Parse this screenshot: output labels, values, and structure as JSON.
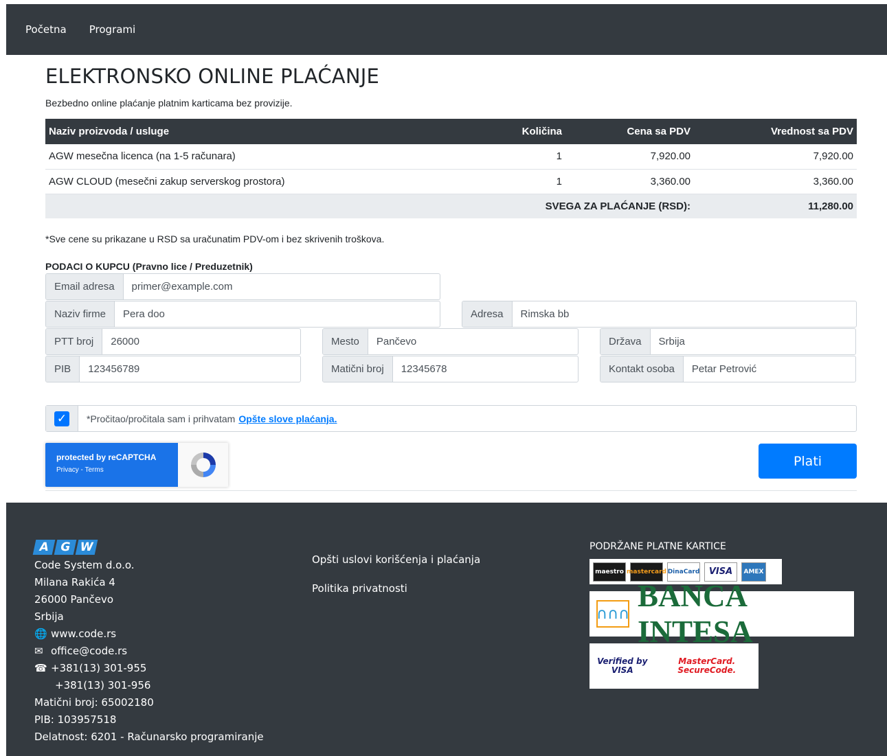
{
  "nav": {
    "items": [
      "Početna",
      "Programi"
    ]
  },
  "page": {
    "title": "ELEKTRONSKO ONLINE PLAĆANJE",
    "subtitle": "Bezbedno online plaćanje platnim karticama bez provizije."
  },
  "table": {
    "headers": [
      "Naziv proizvoda / usluge",
      "Količina",
      "Cena sa PDV",
      "Vrednost sa PDV"
    ],
    "rows": [
      [
        "AGW mesečna licenca (na 1-5 računara)",
        "1",
        "7,920.00",
        "7,920.00"
      ],
      [
        "AGW CLOUD (mesečni zakup serverskog prostora)",
        "1",
        "3,360.00",
        "3,360.00"
      ]
    ],
    "total_label": "SVEGA ZA PLAĆANJE (RSD):",
    "total_value": "11,280.00"
  },
  "note": "*Sve cene su prikazane u RSD sa uračunatim PDV-om i bez skrivenih troškova.",
  "customer": {
    "section_title": "PODACI O KUPCU (Pravno lice / Preduzetnik)",
    "email_label": "Email adresa",
    "email_placeholder": "primer@example.com",
    "firma_label": "Naziv firme",
    "firma_value": "Pera doo",
    "adresa_label": "Adresa",
    "adresa_value": "Rimska bb",
    "ptt_label": "PTT broj",
    "ptt_value": "26000",
    "mesto_label": "Mesto",
    "mesto_value": "Pančevo",
    "drzava_label": "Država",
    "drzava_value": "Srbija",
    "pib_label": "PIB",
    "pib_value": "123456789",
    "mb_label": "Matični broj",
    "mb_value": "12345678",
    "kontakt_label": "Kontakt osoba",
    "kontakt_value": "Petar Petrović"
  },
  "terms": {
    "checked": true,
    "text": "*Pročitao/pročitala sam i prihvatam",
    "link": "Opšte slove plaćanja."
  },
  "recaptcha": {
    "line1": "protected by reCAPTCHA",
    "line2": "Privacy - Terms"
  },
  "pay_label": "Plati",
  "footer": {
    "logo_letters": [
      "A",
      "G",
      "W"
    ],
    "company": "Code System d.o.o.",
    "street": "Milana Rakića 4",
    "city": "26000 Pančevo",
    "country": "Srbija",
    "web": "www.code.rs",
    "email": "office@code.rs",
    "phone1": "+381(13) 301-955",
    "phone2": "+381(13) 301-956",
    "mb": "Matični broj: 65002180",
    "pib": "PIB: 103957518",
    "activity": "Delatnost: 6201 - Računarsko programiranje",
    "links": [
      "Opšti uslovi korišćenja i plaćanja",
      "Politika privatnosti"
    ],
    "cards_title": "PODRŽANE PLATNE KARTICE",
    "cards": [
      "maestro",
      "mastercard",
      "DinaCard",
      "VISA",
      "AMEX"
    ],
    "bank": "BANCA INTESA",
    "verified_visa": "Verified by VISA",
    "mc_secure": "MasterCard. SecureCode."
  },
  "colors": {
    "dark": "#343a40",
    "primary": "#007bff",
    "recaptcha": "#1a73e8"
  }
}
